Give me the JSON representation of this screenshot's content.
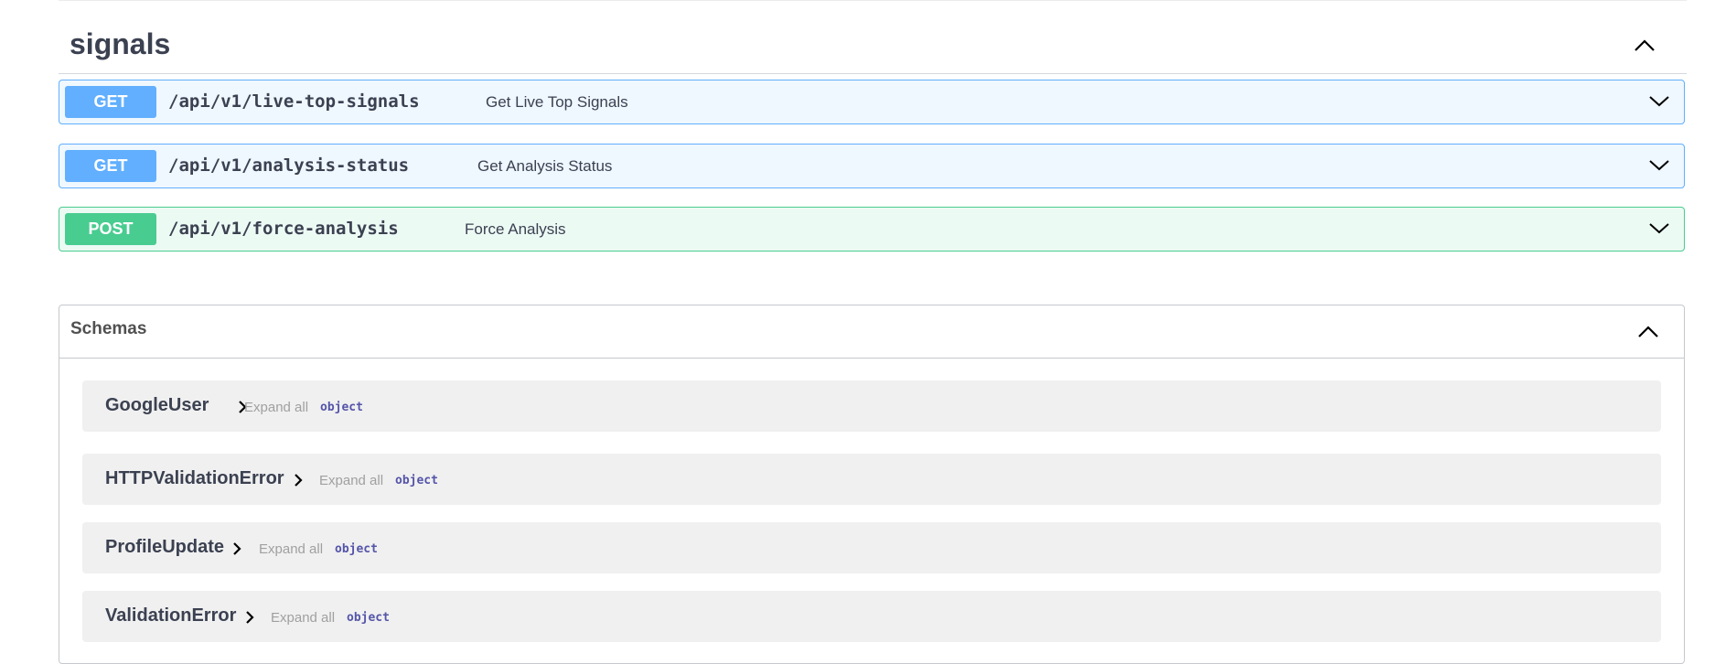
{
  "tag": {
    "title": "signals",
    "toggle_icon": "chevron-up-icon"
  },
  "operations": [
    {
      "method": "GET",
      "path": "/api/v1/live-top-signals",
      "summary": "Get Live Top Signals",
      "color": "#61affe"
    },
    {
      "method": "GET",
      "path": "/api/v1/analysis-status",
      "summary": "Get Analysis Status",
      "color": "#61affe"
    },
    {
      "method": "POST",
      "path": "/api/v1/force-analysis",
      "summary": "Force Analysis",
      "color": "#49cc90"
    }
  ],
  "schemas": {
    "title": "Schemas",
    "toggle_icon": "chevron-up-icon",
    "models": [
      {
        "name": "GoogleUser",
        "expand_label": "Expand all",
        "type": "object"
      },
      {
        "name": "HTTPValidationError",
        "expand_label": "Expand all",
        "type": "object"
      },
      {
        "name": "ProfileUpdate",
        "expand_label": "Expand all",
        "type": "object"
      },
      {
        "name": "ValidationError",
        "expand_label": "Expand all",
        "type": "object"
      }
    ]
  },
  "colors": {
    "get": "#61affe",
    "post": "#49cc90",
    "model_bg": "#f0f0f0",
    "type_text": "#5555aa"
  }
}
